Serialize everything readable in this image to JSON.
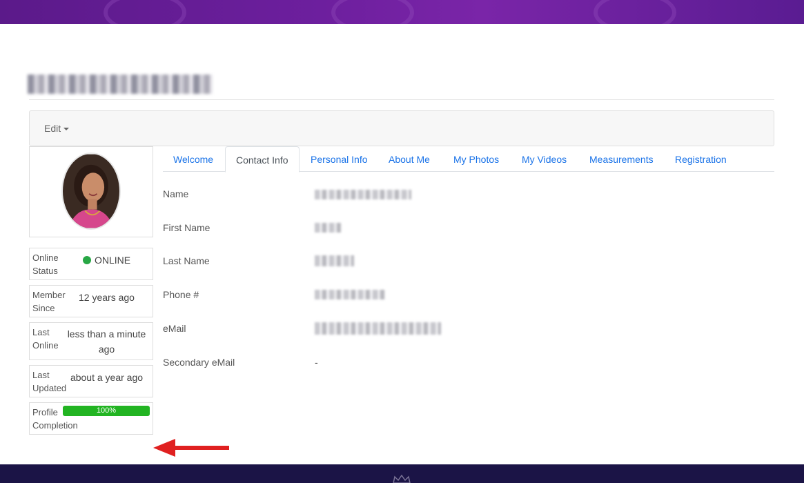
{
  "toolbar": {
    "edit_label": "Edit"
  },
  "tabs": [
    {
      "label": "Welcome",
      "active": false
    },
    {
      "label": "Contact Info",
      "active": true
    },
    {
      "label": "Personal Info",
      "active": false
    },
    {
      "label": "About Me",
      "active": false
    },
    {
      "label": "My Photos",
      "active": false
    },
    {
      "label": "My Videos",
      "active": false
    },
    {
      "label": "Measurements",
      "active": false
    },
    {
      "label": "Registration",
      "active": false
    }
  ],
  "sidebar": {
    "online_status": {
      "label": "Online Status",
      "value": "ONLINE"
    },
    "member_since": {
      "label": "Member Since",
      "value": "12 years ago"
    },
    "last_online": {
      "label": "Last Online",
      "value": "less than a minute ago"
    },
    "last_updated": {
      "label": "Last Updated",
      "value": "about a year ago"
    },
    "profile_completion": {
      "label": "Profile Completion",
      "value": "100%",
      "percent": 100
    }
  },
  "contact": {
    "name_label": "Name",
    "first_name_label": "First Name",
    "last_name_label": "Last Name",
    "phone_label": "Phone #",
    "email_label": "eMail",
    "secondary_email_label": "Secondary eMail",
    "secondary_email_value": "-"
  },
  "colors": {
    "accent": "#1a73e8",
    "online": "#28a745",
    "progress": "#22b422",
    "banner": "#6d1f9e",
    "footer": "#1b1446",
    "arrow": "#e02020"
  }
}
